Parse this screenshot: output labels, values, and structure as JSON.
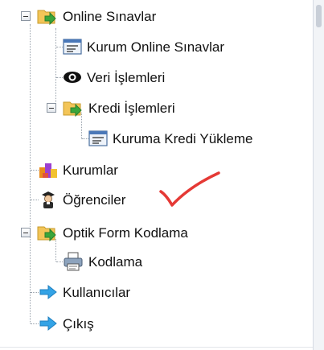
{
  "tree": {
    "items": [
      {
        "label": "Online Sınavlar",
        "icon": "folder-arrow-icon",
        "expanded": true
      },
      {
        "label": "Kurum Online Sınavlar",
        "icon": "form-icon"
      },
      {
        "label": "Veri İşlemleri",
        "icon": "eye-icon"
      },
      {
        "label": "Kredi İşlemleri",
        "icon": "folder-arrow-icon",
        "expanded": true
      },
      {
        "label": "Kuruma Kredi Yükleme",
        "icon": "form-icon"
      },
      {
        "label": "Kurumlar",
        "icon": "building-blocks-icon"
      },
      {
        "label": "Öğrenciler",
        "icon": "graduate-icon"
      },
      {
        "label": "Optik Form Kodlama",
        "icon": "folder-arrow-icon",
        "expanded": true
      },
      {
        "label": "Kodlama",
        "icon": "printer-icon"
      },
      {
        "label": "Kullanıcılar",
        "icon": "arrow-right-icon"
      },
      {
        "label": "Çıkış",
        "icon": "arrow-right-icon"
      }
    ]
  },
  "colors": {
    "annotation_check": "#e53935",
    "folder": "#f3c558",
    "arrow": "#33a3e6",
    "folder_arrow": "#3aa63a"
  }
}
